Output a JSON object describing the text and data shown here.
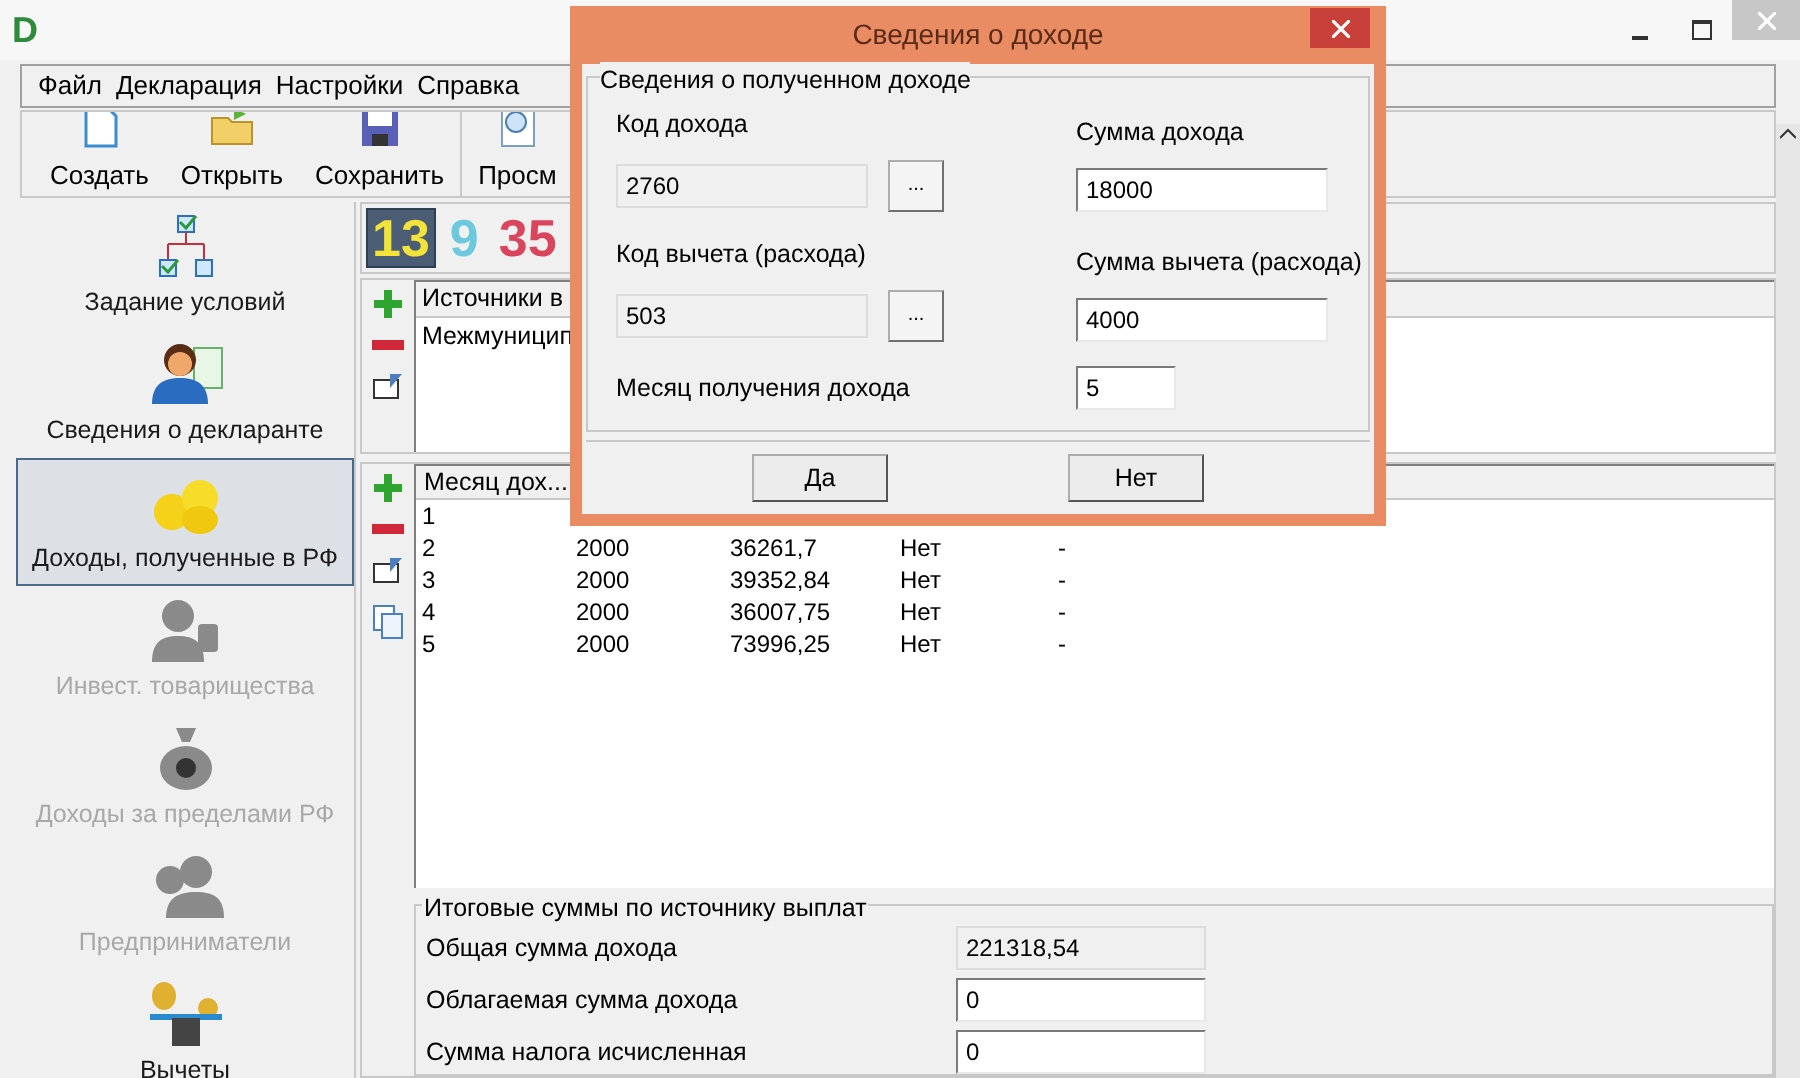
{
  "window": {
    "logo_text": "D"
  },
  "menu": [
    "Файл",
    "Декларация",
    "Настройки",
    "Справка"
  ],
  "toolbar": [
    {
      "label": "Создать",
      "kind": "new"
    },
    {
      "label": "Открыть",
      "kind": "open"
    },
    {
      "label": "Сохранить",
      "kind": "save"
    },
    {
      "label": "Просм",
      "kind": "preview"
    }
  ],
  "sidebar": [
    {
      "label": "Задание условий",
      "kind": "conditions",
      "selected": false,
      "disabled": false
    },
    {
      "label": "Сведения о декларанте",
      "kind": "person",
      "selected": false,
      "disabled": false
    },
    {
      "label": "Доходы, полученные в РФ",
      "kind": "coins",
      "selected": true,
      "disabled": false
    },
    {
      "label": "Инвест. товарищества",
      "kind": "investor",
      "selected": false,
      "disabled": true
    },
    {
      "label": "Доходы за пределами РФ",
      "kind": "moneybag",
      "selected": false,
      "disabled": true
    },
    {
      "label": "Предприниматели",
      "kind": "business",
      "selected": false,
      "disabled": true
    },
    {
      "label": "Вычеты",
      "kind": "scales",
      "selected": false,
      "disabled": false
    }
  ],
  "rate_tabs": [
    {
      "label": "13",
      "selected": true
    },
    {
      "label": "9",
      "selected": false
    },
    {
      "label": "35",
      "selected": false
    }
  ],
  "sources_table": {
    "column": "Источники в",
    "rows": [
      "Межмуницип"
    ]
  },
  "income_table": {
    "column": "Месяц дох...",
    "rows": [
      [
        "1"
      ],
      [
        "2",
        "2000",
        "36261,7",
        "Нет",
        "-"
      ],
      [
        "3",
        "2000",
        "39352,84",
        "Нет",
        "-"
      ],
      [
        "4",
        "2000",
        "36007,75",
        "Нет",
        "-"
      ],
      [
        "5",
        "2000",
        "73996,25",
        "Нет",
        "-"
      ]
    ]
  },
  "totals": {
    "title": "Итоговые суммы по источнику выплат",
    "fields": [
      {
        "label": "Общая сумма дохода",
        "value": "221318,54",
        "readonly": true
      },
      {
        "label": "Облагаемая сумма дохода",
        "value": "0",
        "readonly": false
      },
      {
        "label": "Сумма налога исчисленная",
        "value": "0",
        "readonly": false
      }
    ]
  },
  "dialog": {
    "title": "Сведения о доходе",
    "group": "Сведения о полученном доходе",
    "fields": [
      {
        "label": "Код дохода",
        "value": "2760",
        "readonly": true,
        "browse": "..."
      },
      {
        "label": "Сумма дохода",
        "value": "18000",
        "readonly": false
      },
      {
        "label": "Код вычета (расхода)",
        "value": "503",
        "readonly": true,
        "browse": "..."
      },
      {
        "label": "Сумма вычета (расхода)",
        "value": "4000",
        "readonly": false
      },
      {
        "label": "Месяц получения дохода",
        "value": "5",
        "readonly": false
      }
    ],
    "buttons": [
      "Да",
      "Нет"
    ]
  }
}
